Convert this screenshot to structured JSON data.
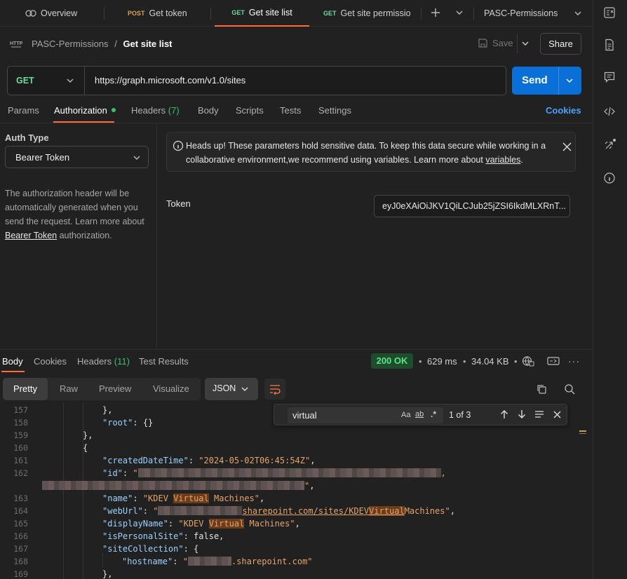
{
  "tabs": [
    {
      "method": "",
      "label": "Overview"
    },
    {
      "method": "POST",
      "label": "Get token"
    },
    {
      "method": "GET",
      "label": "Get site list",
      "active": true
    },
    {
      "method": "GET",
      "label": "Get site permissions"
    }
  ],
  "environment": "PASC-Permissions",
  "breadcrumb": {
    "collection": "PASC-Permissions",
    "sep": "/",
    "request": "Get site list"
  },
  "header": {
    "save": "Save",
    "share": "Share"
  },
  "request": {
    "method": "GET",
    "url": "https://graph.microsoft.com/v1.0/sites",
    "send": "Send"
  },
  "request_tabs": {
    "params": "Params",
    "authorization": "Authorization",
    "headers": "Headers",
    "headers_count": "(7)",
    "body": "Body",
    "scripts": "Scripts",
    "tests": "Tests",
    "settings": "Settings",
    "cookies": "Cookies"
  },
  "auth": {
    "type_label": "Auth Type",
    "type_value": "Bearer Token",
    "desc_1": "The authorization header will be",
    "desc_2": "automatically generated when you",
    "desc_3": "send the request. Learn more about",
    "desc_link": "Bearer Token",
    "desc_4": " authorization.",
    "notice_line1": "Heads up! These parameters hold sensitive data. To keep this data secure while working in a",
    "notice_line2": "collaborative environment,we recommend using variables. Learn more about ",
    "notice_link": "variables",
    "notice_end": ".",
    "token_label": "Token",
    "token_value": "eyJ0eXAiOiJKV1QiLCJub25jZSI6IkdMLXRnT..."
  },
  "response": {
    "tabs": {
      "body": "Body",
      "cookies": "Cookies",
      "headers": "Headers",
      "headers_count": "(11)",
      "test_results": "Test Results"
    },
    "status": "200 OK",
    "time": "629 ms",
    "size": "34.04 KB",
    "views": {
      "pretty": "Pretty",
      "raw": "Raw",
      "preview": "Preview",
      "visualize": "Visualize"
    },
    "format": "JSON"
  },
  "find": {
    "query": "virtual",
    "case": "Aa",
    "word": "ab",
    "regex": ".*",
    "count": "1 of 3"
  },
  "code": {
    "line_numbers": [
      "157",
      "158",
      "159",
      "160",
      "161",
      "162",
      "",
      "163",
      "164",
      "165",
      "166",
      "167",
      "168",
      "169"
    ],
    "closebrace": "},",
    "root_key": "\"root\"",
    "root_val": "{}",
    "close_obj": "},",
    "open_obj": "{",
    "created_key": "\"createdDateTime\"",
    "created_val": "\"2024-05-02T06:45:54Z\"",
    "id_key": "\"id\"",
    "name_key": "\"name\"",
    "name_pre": "\"KDEV ",
    "name_hl": "Virtual",
    "name_post": " Machines\"",
    "weburl_key": "\"webUrl\"",
    "weburl_mid": "sharepoint.com/sites/KDEV",
    "weburl_hl": "Virtual",
    "weburl_post": "Machines\"",
    "display_key": "\"displayName\"",
    "display_pre": "\"KDEV ",
    "display_hl": "Virtual",
    "display_post": " Machines\"",
    "personal_key": "\"isPersonalSite\"",
    "personal_val": "false",
    "sitecoll_key": "\"siteCollection\"",
    "hostname_key": "\"hostname\"",
    "hostname_val": ".sharepoint.com\"",
    "last_close": "},"
  }
}
